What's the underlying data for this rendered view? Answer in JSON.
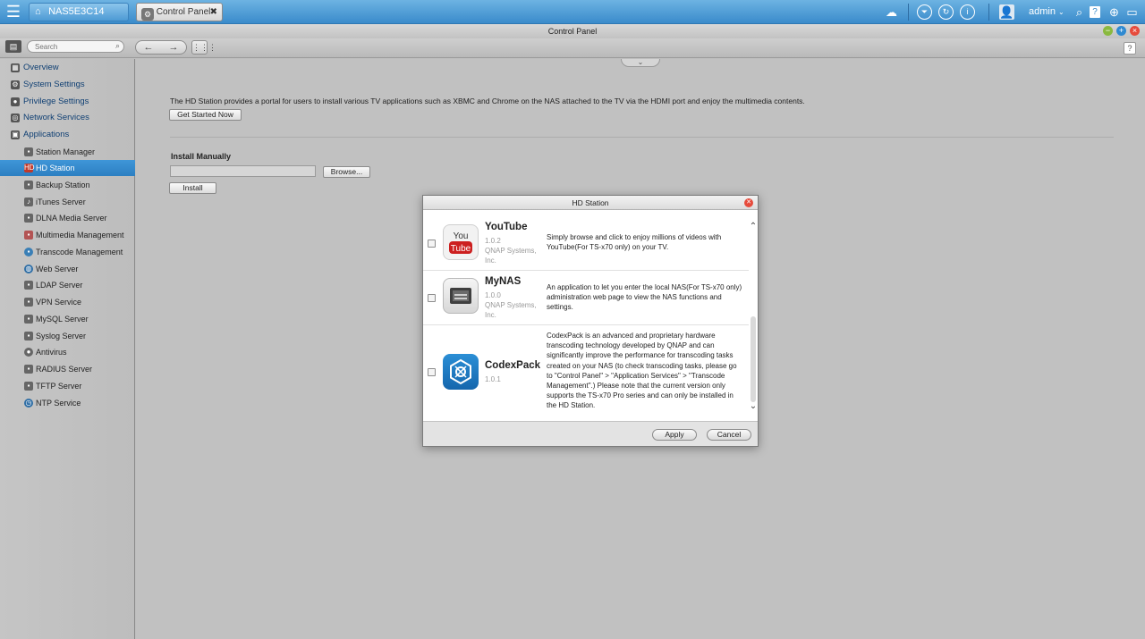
{
  "topbar": {
    "device_name": "NAS5E3C14",
    "window_tab": "Control Panel",
    "user": "admin"
  },
  "window": {
    "title": "Control Panel"
  },
  "toolbar": {
    "search_placeholder": "Search"
  },
  "sidebar": {
    "sections": [
      {
        "label": "Overview",
        "icon": "overview-icon"
      },
      {
        "label": "System Settings",
        "icon": "gear-icon"
      },
      {
        "label": "Privilege Settings",
        "icon": "user-icon"
      },
      {
        "label": "Network Services",
        "icon": "network-icon"
      },
      {
        "label": "Applications",
        "icon": "applications-icon"
      }
    ],
    "applications": [
      {
        "label": "Station Manager"
      },
      {
        "label": "HD Station",
        "selected": true
      },
      {
        "label": "Backup Station"
      },
      {
        "label": "iTunes Server"
      },
      {
        "label": "DLNA Media Server"
      },
      {
        "label": "Multimedia Management"
      },
      {
        "label": "Transcode Management"
      },
      {
        "label": "Web Server"
      },
      {
        "label": "LDAP Server"
      },
      {
        "label": "VPN Service"
      },
      {
        "label": "MySQL Server"
      },
      {
        "label": "Syslog Server"
      },
      {
        "label": "Antivirus"
      },
      {
        "label": "RADIUS Server"
      },
      {
        "label": "TFTP Server"
      },
      {
        "label": "NTP Service"
      }
    ]
  },
  "main": {
    "intro": "The HD Station provides a portal for users to install various TV applications such as XBMC and Chrome on the NAS attached to the TV via the HDMI port and enjoy the multimedia contents.",
    "get_started_label": "Get Started Now",
    "install_manually_title": "Install Manually",
    "browse_label": "Browse...",
    "install_label": "Install"
  },
  "dialog": {
    "title": "HD Station",
    "apply_label": "Apply",
    "cancel_label": "Cancel",
    "apps": [
      {
        "name": "YouTube",
        "version": "1.0.2",
        "vendor": "QNAP Systems, Inc.",
        "description": "Simply browse and click to enjoy millions of videos with YouTube(For TS-x70 only) on your TV.",
        "icon": "youtube-icon"
      },
      {
        "name": "MyNAS",
        "version": "1.0.0",
        "vendor": "QNAP Systems, Inc.",
        "description": "An application to let you enter the local NAS(For TS-x70 only) administration web page to view the NAS functions and settings.",
        "icon": "mynas-icon"
      },
      {
        "name": "CodexPack",
        "version": "1.0.1",
        "vendor": "",
        "description": "CodexPack is an advanced and proprietary hardware transcoding technology developed by QNAP and can significantly improve the performance for transcoding tasks created on your NAS (to check transcoding tasks, please go to \"Control Panel\" > \"Application Services\" > \"Transcode Management\".) Please note that the current version only supports the TS-x70 Pro series and can only be installed in the HD Station.",
        "icon": "codexpack-icon"
      }
    ]
  },
  "colors": {
    "topbar": "#4a9ad6",
    "selected": "#3489cc",
    "close_red": "#e64b3c"
  }
}
